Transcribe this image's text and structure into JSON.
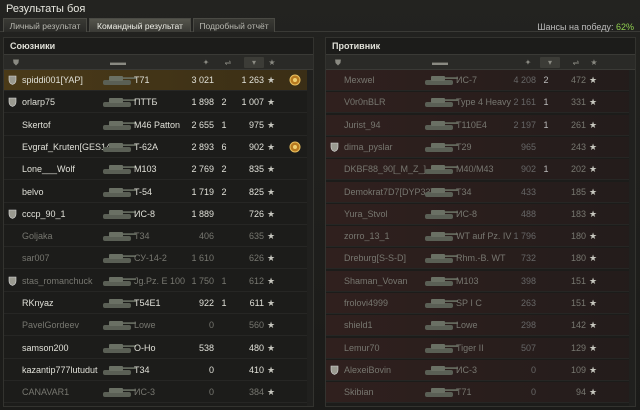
{
  "window": {
    "title": "Результаты боя",
    "win_chance_label": "Шансы на победу:",
    "win_chance_value": "62%"
  },
  "tabs": [
    {
      "label": "Личный результат"
    },
    {
      "label": "Командный результат"
    },
    {
      "label": "Подробный отчёт"
    }
  ],
  "allies": {
    "title": "Союзники",
    "rows": [
      {
        "name": "spiddi001[YAP]",
        "tank": "T71",
        "damage": "3 021",
        "frags": "",
        "xp": "1 263",
        "platoon": true,
        "medal": true,
        "me": true,
        "dead": false
      },
      {
        "name": "orlarp75",
        "tank": "ПТТБ",
        "damage": "1 898",
        "frags": "2",
        "xp": "1 007",
        "platoon": true,
        "medal": false,
        "me": false,
        "dead": false
      },
      {
        "name": "Skertof",
        "tank": "M46 Patton",
        "damage": "2 655",
        "frags": "1",
        "xp": "975",
        "platoon": false,
        "medal": false,
        "me": false,
        "dead": false
      },
      {
        "name": "Evgraf_Kruten[GES14]",
        "tank": "T-62A",
        "damage": "2 893",
        "frags": "6",
        "xp": "902",
        "platoon": false,
        "medal": true,
        "me": false,
        "dead": false
      },
      {
        "name": "Lone___Wolf",
        "tank": "M103",
        "damage": "2 769",
        "frags": "2",
        "xp": "835",
        "platoon": false,
        "medal": false,
        "me": false,
        "dead": false
      },
      {
        "name": "belvo",
        "tank": "T-54",
        "damage": "1 719",
        "frags": "2",
        "xp": "825",
        "platoon": false,
        "medal": false,
        "me": false,
        "dead": false
      },
      {
        "name": "cccp_90_1",
        "tank": "ИС-8",
        "damage": "1 889",
        "frags": "",
        "xp": "726",
        "platoon": true,
        "medal": false,
        "me": false,
        "dead": false
      },
      {
        "name": "Goljaka",
        "tank": "T34",
        "damage": "406",
        "frags": "",
        "xp": "635",
        "platoon": false,
        "medal": false,
        "me": false,
        "dead": true
      },
      {
        "name": "sar007",
        "tank": "СУ-14-2",
        "damage": "1 610",
        "frags": "",
        "xp": "626",
        "platoon": false,
        "medal": false,
        "me": false,
        "dead": true
      },
      {
        "name": "stas_romanchuck",
        "tank": "Jg.Pz. E 100",
        "damage": "1 750",
        "frags": "1",
        "xp": "612",
        "platoon": true,
        "medal": false,
        "me": false,
        "dead": true
      },
      {
        "name": "RKnyaz",
        "tank": "T54E1",
        "damage": "922",
        "frags": "1",
        "xp": "611",
        "platoon": false,
        "medal": false,
        "me": false,
        "dead": false
      },
      {
        "name": "PavelGordeev",
        "tank": "Lowe",
        "damage": "0",
        "frags": "",
        "xp": "560",
        "platoon": false,
        "medal": false,
        "me": false,
        "dead": true
      },
      {
        "name": "samson200",
        "tank": "O-Ho",
        "damage": "538",
        "frags": "",
        "xp": "480",
        "platoon": false,
        "medal": false,
        "me": false,
        "dead": false
      },
      {
        "name": "kazantip777lutudut",
        "tank": "T34",
        "damage": "0",
        "frags": "",
        "xp": "410",
        "platoon": false,
        "medal": false,
        "me": false,
        "dead": false
      },
      {
        "name": "CANAVAR1",
        "tank": "ИС-3",
        "damage": "0",
        "frags": "",
        "xp": "384",
        "platoon": false,
        "medal": false,
        "me": false,
        "dead": true
      }
    ]
  },
  "enemies": {
    "title": "Противник",
    "rows": [
      {
        "name": "Mexwel",
        "tank": "ИС-7",
        "damage": "4 208",
        "frags": "2",
        "xp": "472",
        "platoon": false,
        "dead": true
      },
      {
        "name": "V0r0nBLR",
        "tank": "Type 4 Heavy",
        "damage": "2 161",
        "frags": "1",
        "xp": "331",
        "platoon": false,
        "dead": true
      },
      {
        "name": "Jurist_94",
        "tank": "T110E4",
        "damage": "2 197",
        "frags": "1",
        "xp": "261",
        "platoon": false,
        "dead": true
      },
      {
        "name": "dima_pyslar",
        "tank": "T29",
        "damage": "965",
        "frags": "",
        "xp": "243",
        "platoon": true,
        "dead": true
      },
      {
        "name": "DKBF88_90[_M_Z_]",
        "tank": "M40/M43",
        "damage": "902",
        "frags": "1",
        "xp": "202",
        "platoon": false,
        "dead": true
      },
      {
        "name": "Demokrat7D7[DYP33]",
        "tank": "T34",
        "damage": "433",
        "frags": "",
        "xp": "185",
        "platoon": false,
        "dead": true
      },
      {
        "name": "Yura_Stvol",
        "tank": "ИС-8",
        "damage": "488",
        "frags": "",
        "xp": "183",
        "platoon": false,
        "dead": true
      },
      {
        "name": "zorro_13_1",
        "tank": "WT auf Pz. IV",
        "damage": "1 796",
        "frags": "",
        "xp": "180",
        "platoon": false,
        "dead": true
      },
      {
        "name": "Dreburg[S-S-D]",
        "tank": "Rhm.-B. WT",
        "damage": "732",
        "frags": "",
        "xp": "180",
        "platoon": false,
        "dead": true
      },
      {
        "name": "Shaman_Vovan",
        "tank": "M103",
        "damage": "398",
        "frags": "",
        "xp": "151",
        "platoon": false,
        "dead": true
      },
      {
        "name": "frolovi4999",
        "tank": "SP I C",
        "damage": "263",
        "frags": "",
        "xp": "151",
        "platoon": false,
        "dead": true
      },
      {
        "name": "shield1",
        "tank": "Lowe",
        "damage": "298",
        "frags": "",
        "xp": "142",
        "platoon": false,
        "dead": true
      },
      {
        "name": "Lemur70",
        "tank": "Tiger II",
        "damage": "507",
        "frags": "",
        "xp": "129",
        "platoon": false,
        "dead": true
      },
      {
        "name": "AlexeiBovin",
        "tank": "ИС-3",
        "damage": "0",
        "frags": "",
        "xp": "109",
        "platoon": true,
        "dead": true
      },
      {
        "name": "Skibian",
        "tank": "T71",
        "damage": "0",
        "frags": "",
        "xp": "94",
        "platoon": false,
        "dead": true
      }
    ]
  },
  "icons": {
    "platoon": "platoon-shield-icon",
    "star": "star-icon",
    "medal": "medal-icon",
    "tank": "tank-silhouette-icon"
  },
  "colors": {
    "win_chance": "#90d050",
    "me_row": "#4a3a18",
    "enemy_row": "#3a1f1c"
  }
}
